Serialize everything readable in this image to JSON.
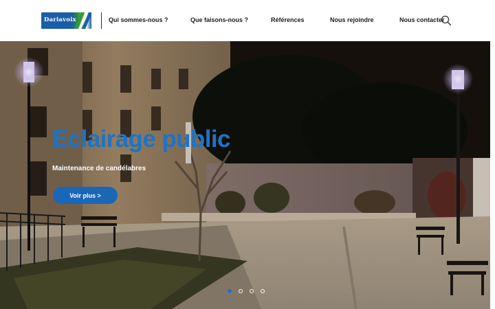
{
  "header": {
    "logo": {
      "text": "Dariavoix"
    },
    "nav": [
      {
        "label": "Qui sommes-nous ?"
      },
      {
        "label": "Que faisons-nous ?"
      },
      {
        "label": "Références"
      },
      {
        "label": "Nous rejoindre"
      },
      {
        "label": "Nous contacter"
      }
    ],
    "search_icon": "search-icon"
  },
  "hero": {
    "title": "Eclairage public",
    "subtitle": "Maintenance de candélabres",
    "cta_label": "Voir plus >",
    "slides_count": 4,
    "active_slide": 1
  },
  "colors": {
    "accent": "#1f73c4",
    "cta": "#1a67b8",
    "nav_text": "#1c1c1c"
  }
}
